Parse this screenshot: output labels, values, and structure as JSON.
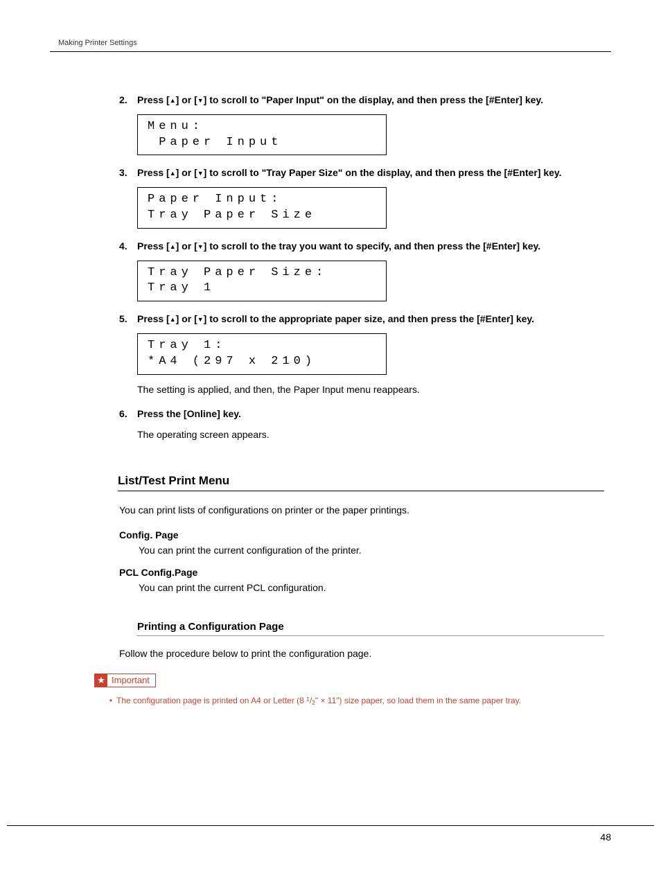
{
  "header": {
    "title": "Making Printer Settings"
  },
  "steps": [
    {
      "num": "2.",
      "text_before": "Press [",
      "text_mid1": "] or [",
      "text_mid2": "] to scroll to \"Paper Input\" on the display, and then press the [#Enter] key.",
      "display": "Menu:\n Paper Input"
    },
    {
      "num": "3.",
      "text_before": "Press [",
      "text_mid1": "] or [",
      "text_mid2": "] to scroll to \"Tray Paper Size\" on the display, and then press the [#Enter] key.",
      "display": "Paper Input:\nTray Paper Size"
    },
    {
      "num": "4.",
      "text_before": "Press [",
      "text_mid1": "] or [",
      "text_mid2": "] to scroll to the tray you want to specify, and then press the [#Enter] key.",
      "display": "Tray Paper Size:\nTray 1"
    },
    {
      "num": "5.",
      "text_before": "Press [",
      "text_mid1": "] or [",
      "text_mid2": "] to scroll to the appropriate paper size, and then press the [#Enter] key.",
      "display": "Tray 1:\n*A4 (297 x 210)",
      "after": "The setting is applied, and then, the Paper Input menu reappears."
    },
    {
      "num": "6.",
      "plain": "Press the [Online] key.",
      "after": "The operating screen appears."
    }
  ],
  "section": {
    "heading": "List/Test Print Menu",
    "intro": "You can print lists of configurations on printer or the paper printings.",
    "items": [
      {
        "term": "Config. Page",
        "desc": "You can print the current configuration of the printer."
      },
      {
        "term": "PCL Config.Page",
        "desc": "You can print the current PCL configuration."
      }
    ]
  },
  "subsection": {
    "heading": "Printing a Configuration Page",
    "intro": "Follow the procedure below to print the configuration page.",
    "important_label": "Important",
    "note_before": "The configuration page is printed on A4 or Letter (8 ",
    "note_sup": "1",
    "note_slash": "/",
    "note_sub": "2",
    "note_after": "\" × 11\") size paper, so load them in the same paper tray."
  },
  "page_number": "48"
}
